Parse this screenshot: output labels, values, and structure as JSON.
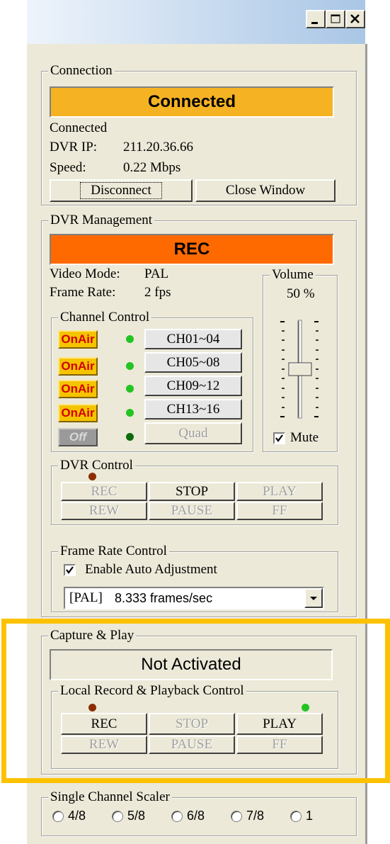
{
  "window": {
    "controls": {
      "minimize_icon": "minimize-icon",
      "maximize_icon": "maximize-icon",
      "close_icon": "close-icon"
    }
  },
  "connection": {
    "legend": "Connection",
    "status_panel": "Connected",
    "status_text": "Connected",
    "ip_label": "DVR IP:",
    "ip_value": "211.20.36.66",
    "speed_label": "Speed:",
    "speed_value": "0.22 Mbps",
    "disconnect_label": "Disconnect",
    "close_label": "Close Window",
    "panel_color": "#f5b323"
  },
  "dvr_management": {
    "legend": "DVR Management",
    "status_panel": "REC",
    "panel_color": "#ff6a00",
    "video_mode_label": "Video Mode:",
    "video_mode_value": "PAL",
    "frame_rate_label": "Frame Rate:",
    "frame_rate_value": "2 fps",
    "volume": {
      "legend": "Volume",
      "value": "50 %",
      "level": 0.5,
      "mute_label": "Mute",
      "mute_checked": true
    },
    "channel_control": {
      "legend": "Channel Control",
      "rows": [
        {
          "toggle": "OnAir",
          "led": "green",
          "channel": "CH01~04",
          "enabled": true
        },
        {
          "toggle": "OnAir",
          "led": "green",
          "channel": "CH05~08",
          "enabled": true
        },
        {
          "toggle": "OnAir",
          "led": "green",
          "channel": "CH09~12",
          "enabled": true
        },
        {
          "toggle": "OnAir",
          "led": "green",
          "channel": "CH13~16",
          "enabled": true
        },
        {
          "toggle": "Off",
          "led": "dark-green",
          "channel": "Quad",
          "enabled": false
        }
      ]
    },
    "dvr_control": {
      "legend": "DVR Control",
      "rec": "REC",
      "stop": "STOP",
      "play": "PLAY",
      "rew": "REW",
      "pause": "PAUSE",
      "ff": "FF"
    },
    "frame_rate_control": {
      "legend": "Frame Rate Control",
      "auto_label": "Enable Auto Adjustment",
      "auto_checked": true,
      "select_prefix": "[PAL]",
      "select_value": "8.333 frames/sec"
    }
  },
  "capture_play": {
    "legend": "Capture & Play",
    "status_panel": "Not Activated",
    "local": {
      "legend": "Local Record & Playback Control",
      "rec": "REC",
      "stop": "STOP",
      "play": "PLAY",
      "rew": "REW",
      "pause": "PAUSE",
      "ff": "FF"
    }
  },
  "scaler": {
    "legend": "Single Channel Scaler",
    "options": [
      "4/8",
      "5/8",
      "6/8",
      "7/8",
      "1"
    ]
  },
  "colors": {
    "highlight": "#fcc200",
    "led_green": "#22c422",
    "led_brown": "#8b2e00"
  }
}
